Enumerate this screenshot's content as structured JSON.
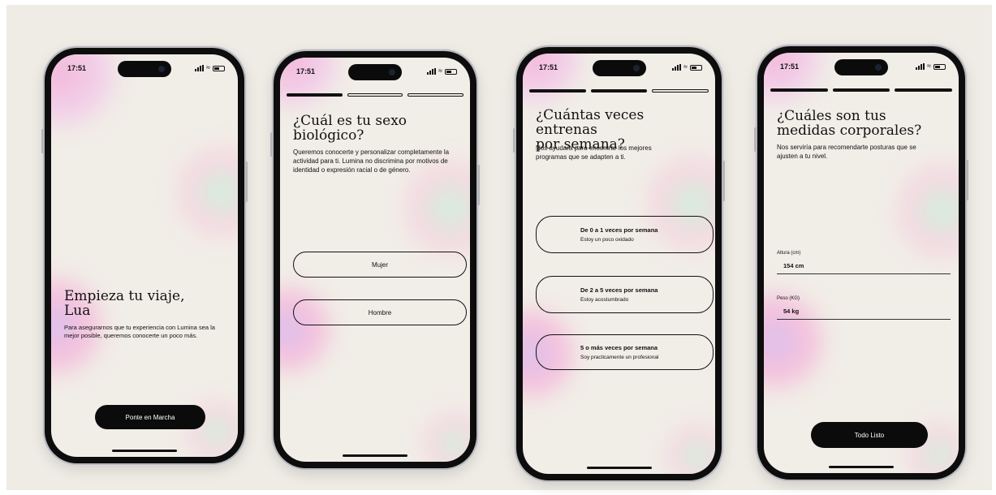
{
  "status": {
    "time": "17:51"
  },
  "screen1": {
    "title_line1": "Empieza tu viaje,",
    "title_line2": "Lua",
    "subtitle": "Para asegurarnos que tu experiencia con Lumina sea la mejor posible, queremos conocerte un poco más.",
    "cta": "Ponte en Marcha"
  },
  "screen2": {
    "title_line1": "¿Cuál es tu sexo",
    "title_line2": "biológico?",
    "subtitle": "Queremos conocerte y personalizar completamente la actividad para ti. Lumina no discrimina por motivos de identidad o expresión racial o de género.",
    "options": [
      "Mujer",
      "Hombre"
    ]
  },
  "screen3": {
    "title_line1": "¿Cuántas veces entrenas",
    "title_line2": "por semana?",
    "subtitle": "Nos ayudara para encontrar los mejores programas que se adapten a ti.",
    "options": [
      {
        "label": "De 0 a 1 veces por semana",
        "sub": "Estoy un poco oxidado"
      },
      {
        "label": "De 2 a 5 veces por semana",
        "sub": "Estoy acostumbrado"
      },
      {
        "label": "5 o más veces por semana",
        "sub": "Soy practicamente un profesional"
      }
    ]
  },
  "screen4": {
    "title_line1": "¿Cuáles son tus",
    "title_line2": "medidas corporales?",
    "subtitle": "Nos serviría para recomendarte posturas que se ajusten a tu nivel.",
    "height_label": "Altura (cm)",
    "height_value": "154 cm",
    "weight_label": "Peso (KG)",
    "weight_value": "54 kg",
    "cta": "Todo Listo"
  }
}
